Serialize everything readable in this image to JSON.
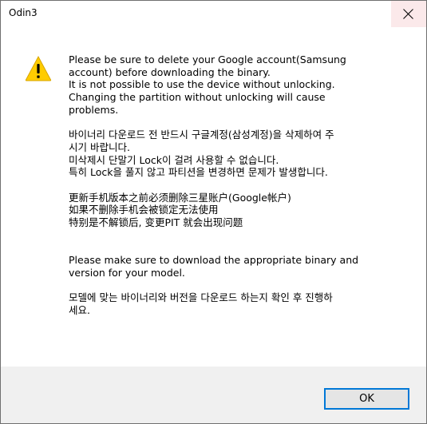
{
  "window": {
    "title": "Odin3"
  },
  "titlebar": {
    "close_icon": "close-icon"
  },
  "dialog": {
    "icon": "warning-icon",
    "icon_color": "#ffcc00",
    "lines": [
      "Please be sure to delete your Google account(Samsung",
      "account) before downloading the binary.",
      "It is not possible to use the device without unlocking.",
      "Changing the partition without unlocking will cause",
      "problems.",
      "바이너리 다운로드 전 반드시 구글계정(삼성계정)을 삭제하여 주",
      "시기 바랍니다.",
      "미삭제시 단말기 Lock이 걸려 사용할 수 없습니다.",
      "특히 Lock을 풀지 않고 파티션을 변경하면 문제가 발생합니다.",
      "更新手机版本之前必须删除三星账户(Google帐户)",
      "如果不删除手机会被锁定无法使用",
      "特别是不解锁后, 变更PIT 就会出现问题",
      "Please make sure to download the appropriate binary and",
      "version for your model.",
      "모델에 맞는 바이너리와 버전을 다운로드 하는지 확인 후 진행하",
      "세요."
    ]
  },
  "footer": {
    "ok_label": "OK"
  },
  "colors": {
    "accent": "#0078d7",
    "close_hover_bg": "#fbe9ea",
    "footer_bg": "#f0f0f0"
  }
}
